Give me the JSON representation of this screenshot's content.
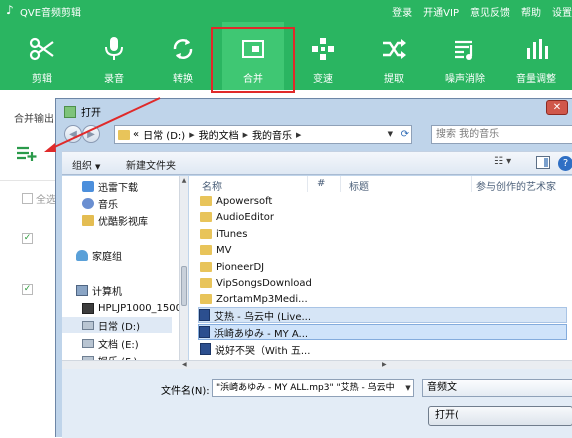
{
  "app": {
    "title": "QVE音频剪辑",
    "top_links": [
      "登录",
      "开通VIP",
      "意见反馈",
      "帮助",
      "设置"
    ]
  },
  "toolbar": {
    "tools": [
      {
        "label": "剪辑",
        "icon": "scissors-icon"
      },
      {
        "label": "录音",
        "icon": "microphone-icon"
      },
      {
        "label": "转换",
        "icon": "convert-icon"
      },
      {
        "label": "合并",
        "icon": "merge-icon"
      },
      {
        "label": "变速",
        "icon": "speed-icon"
      },
      {
        "label": "提取",
        "icon": "extract-icon"
      },
      {
        "label": "噪声消除",
        "icon": "noise-reduction-icon"
      },
      {
        "label": "音量调整",
        "icon": "volume-adjust-icon"
      }
    ],
    "active": "合并"
  },
  "panel": {
    "merge_output_label": "合并输出",
    "select_all_label": "全选"
  },
  "dialog": {
    "title": "打开",
    "close_label": "✕",
    "address": {
      "prefix": "«",
      "segments": [
        "日常 (D:)",
        "我的文档",
        "我的音乐"
      ]
    },
    "search_placeholder": "搜索 我的音乐",
    "commands": {
      "organize": "组织",
      "new_folder": "新建文件夹"
    },
    "nav_items": [
      {
        "label": "迅雷下载",
        "icon": "download-icon"
      },
      {
        "label": "音乐",
        "icon": "music-icon"
      },
      {
        "label": "优酷影视库",
        "icon": "folder-icon"
      },
      {
        "label": "家庭组",
        "icon": "homegroup-icon"
      },
      {
        "label": "计算机",
        "icon": "computer-icon"
      },
      {
        "label": "HPLJP1000_1500",
        "icon": "printer-icon"
      },
      {
        "label": "日常 (D:)",
        "icon": "drive-icon"
      },
      {
        "label": "文档 (E:)",
        "icon": "drive-icon"
      },
      {
        "label": "娱乐 (F:)",
        "icon": "drive-icon"
      }
    ],
    "columns": [
      "名称",
      "#",
      "标题",
      "参与创作的艺术家"
    ],
    "files": [
      {
        "name": "Apowersoft",
        "type": "folder"
      },
      {
        "name": "AudioEditor",
        "type": "folder"
      },
      {
        "name": "iTunes",
        "type": "folder"
      },
      {
        "name": "MV",
        "type": "folder"
      },
      {
        "name": "PioneerDJ",
        "type": "folder"
      },
      {
        "name": "VipSongsDownload",
        "type": "folder"
      },
      {
        "name": "ZortamMp3Medi...",
        "type": "folder"
      },
      {
        "name": "艾热 - 乌云中 (Live...",
        "type": "mp3",
        "selected": true
      },
      {
        "name": "浜崎あゆみ - MY A...",
        "type": "mp3",
        "selected": true
      },
      {
        "name": "说好不哭（With 五...",
        "type": "mp3",
        "selected": false
      }
    ],
    "filename_label": "文件名(N):",
    "filename_value": "\"浜崎あゆみ - MY ALL.mp3\" \"艾热 - 乌云中",
    "filetype_value": "音频文",
    "open_button": "打开("
  }
}
